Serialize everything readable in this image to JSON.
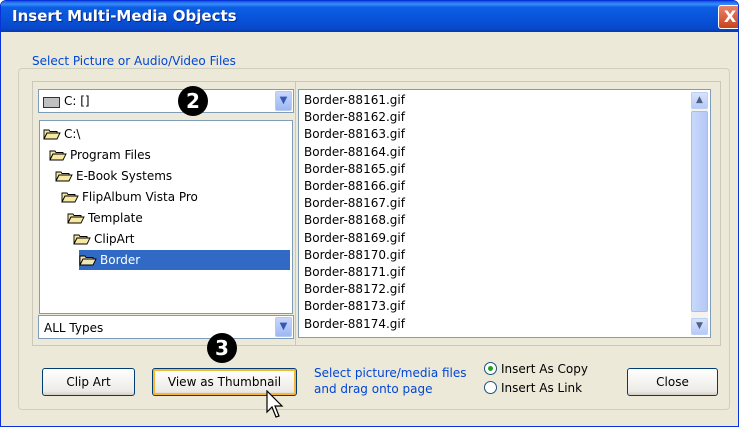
{
  "window": {
    "title": "Insert Multi-Media Objects",
    "close_glyph": "X"
  },
  "group": {
    "label": "Select Picture or Audio/Video Files"
  },
  "drive": {
    "value": "C: []",
    "icon": "drive-icon",
    "dropdown_glyph": "▼"
  },
  "badges": {
    "drive": "2",
    "thumbnail": "3"
  },
  "tree": [
    {
      "label": "C:\\",
      "level": 0,
      "open": true,
      "selected": false
    },
    {
      "label": "Program Files",
      "level": 1,
      "open": true,
      "selected": false
    },
    {
      "label": "E-Book Systems",
      "level": 2,
      "open": true,
      "selected": false
    },
    {
      "label": "FlipAlbum Vista Pro",
      "level": 3,
      "open": true,
      "selected": false
    },
    {
      "label": "Template",
      "level": 4,
      "open": true,
      "selected": false
    },
    {
      "label": "ClipArt",
      "level": 5,
      "open": true,
      "selected": false
    },
    {
      "label": "Border",
      "level": 6,
      "open": true,
      "selected": true
    }
  ],
  "types": {
    "value": "ALL Types",
    "dropdown_glyph": "▼"
  },
  "files": [
    "Border-88161.gif",
    "Border-88162.gif",
    "Border-88163.gif",
    "Border-88164.gif",
    "Border-88165.gif",
    "Border-88166.gif",
    "Border-88167.gif",
    "Border-88168.gif",
    "Border-88169.gif",
    "Border-88170.gif",
    "Border-88171.gif",
    "Border-88172.gif",
    "Border-88173.gif",
    "Border-88174.gif"
  ],
  "scrollbar": {
    "up_glyph": "▲",
    "down_glyph": "▼"
  },
  "buttons": {
    "clip_art": "Clip Art",
    "view_thumbnail": "View as Thumbnail",
    "close": "Close"
  },
  "hint": {
    "line1": "Select picture/media files",
    "line2": "and drag onto page"
  },
  "insert_mode": {
    "options": [
      {
        "label": "Insert As Copy",
        "selected": true
      },
      {
        "label": "Insert As Link",
        "selected": false
      }
    ]
  },
  "colors": {
    "title_blue": "#0a57d8",
    "selection": "#316ac5",
    "hint_blue": "#0046d5",
    "radio_dot": "#21a121"
  }
}
